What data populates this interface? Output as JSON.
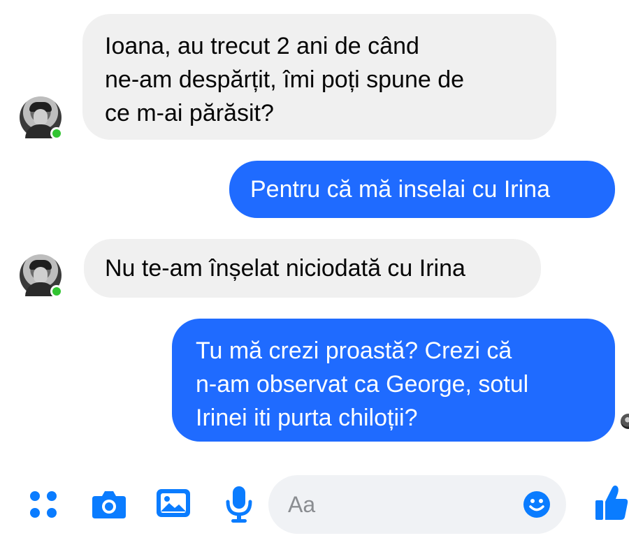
{
  "messages": [
    {
      "direction": "incoming",
      "text": "Ioana, au trecut 2 ani de când\nne-am despărțit, îmi poți spune de\nce m-ai părăsit?"
    },
    {
      "direction": "outgoing",
      "text": "Pentru că mă inselai cu Irina"
    },
    {
      "direction": "incoming",
      "text": "Nu te-am înșelat niciodată cu Irina"
    },
    {
      "direction": "outgoing",
      "text": "Tu mă crezi proastă? Crezi că\nn-am observat ca George, sotul\nIrinei iti purta chiloții?"
    }
  ],
  "composer": {
    "placeholder": "Aa",
    "icons": [
      "more-actions-icon",
      "camera-icon",
      "image-icon",
      "microphone-icon",
      "emoji-icon",
      "like-icon"
    ]
  },
  "colors": {
    "outgoing_bubble": "#1f6bff",
    "incoming_bubble": "#f0f0f0",
    "accent": "#0a7cff",
    "online": "#31c431"
  }
}
